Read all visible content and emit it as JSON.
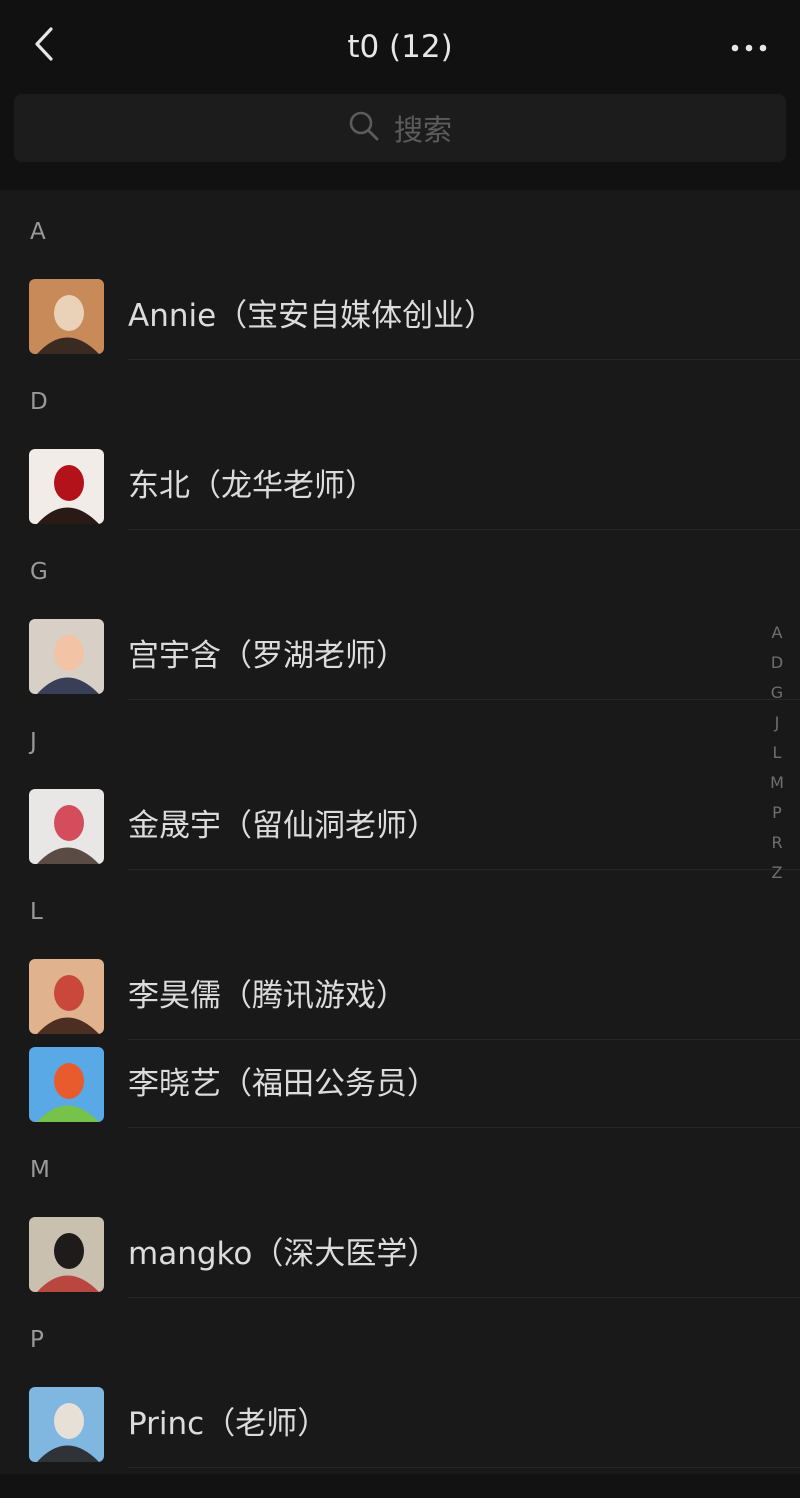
{
  "header": {
    "title": "t0 (12)",
    "back_icon": "chevron-left-icon",
    "more_icon": "more-dots-icon"
  },
  "search": {
    "placeholder": "搜索",
    "icon": "search-icon"
  },
  "sections": [
    {
      "letter": "A",
      "contacts": [
        {
          "name": "Annie（宝安自媒体创业）",
          "avatar_colors": [
            "#c98a5a",
            "#e9d2b8",
            "#3b2a22"
          ]
        }
      ]
    },
    {
      "letter": "D",
      "contacts": [
        {
          "name": "东北（龙华老师）",
          "avatar_colors": [
            "#f2ece8",
            "#b3121b",
            "#2a1a16"
          ]
        }
      ]
    },
    {
      "letter": "G",
      "contacts": [
        {
          "name": "宫宇含（罗湖老师）",
          "avatar_colors": [
            "#d8cfc6",
            "#f3c3a6",
            "#3a3f58"
          ]
        }
      ]
    },
    {
      "letter": "J",
      "contacts": [
        {
          "name": "金晟宇（留仙洞老师）",
          "avatar_colors": [
            "#e9e7e6",
            "#d34d5d",
            "#5a4b44"
          ]
        }
      ]
    },
    {
      "letter": "L",
      "contacts": [
        {
          "name": "李昊儒（腾讯游戏）",
          "avatar_colors": [
            "#e0b28e",
            "#c9473b",
            "#4c2f22"
          ]
        },
        {
          "name": "李晓艺（福田公务员）",
          "avatar_colors": [
            "#59a9e6",
            "#e85b2d",
            "#77c24a"
          ]
        }
      ]
    },
    {
      "letter": "M",
      "contacts": [
        {
          "name": "mangko（深大医学）",
          "avatar_colors": [
            "#c9c0b0",
            "#1f1b1a",
            "#b9463f"
          ]
        }
      ]
    },
    {
      "letter": "P",
      "contacts": [
        {
          "name": "Princ（老师）",
          "avatar_colors": [
            "#7fb7e0",
            "#e7e0d7",
            "#2f3338"
          ]
        }
      ]
    }
  ],
  "index_bar": [
    "A",
    "D",
    "G",
    "J",
    "L",
    "M",
    "P",
    "R",
    "Z"
  ],
  "colors": {
    "background": "#191919",
    "topbar": "#111111",
    "text": "#dcdcdc",
    "section_letter": "#9a9a9a"
  }
}
